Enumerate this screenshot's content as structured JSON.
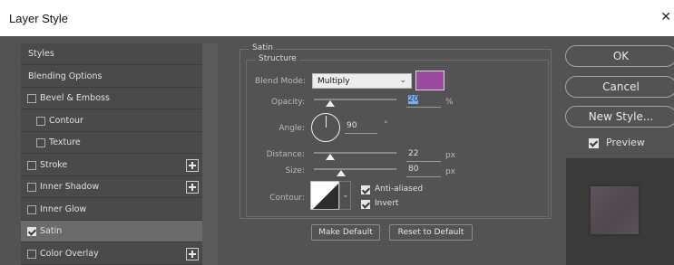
{
  "window": {
    "title": "Layer Style",
    "close_icon": "close-icon"
  },
  "sidebar": {
    "items": [
      {
        "label": "Styles",
        "checkbox": false,
        "checked": false,
        "plus": false,
        "indent": 0,
        "selected": false
      },
      {
        "label": "Blending Options",
        "checkbox": false,
        "checked": false,
        "plus": false,
        "indent": 0,
        "selected": false
      },
      {
        "label": "Bevel & Emboss",
        "checkbox": true,
        "checked": false,
        "plus": false,
        "indent": 0,
        "selected": false
      },
      {
        "label": "Contour",
        "checkbox": true,
        "checked": false,
        "plus": false,
        "indent": 1,
        "selected": false
      },
      {
        "label": "Texture",
        "checkbox": true,
        "checked": false,
        "plus": false,
        "indent": 1,
        "selected": false
      },
      {
        "label": "Stroke",
        "checkbox": true,
        "checked": false,
        "plus": true,
        "indent": 0,
        "selected": false
      },
      {
        "label": "Inner Shadow",
        "checkbox": true,
        "checked": false,
        "plus": true,
        "indent": 0,
        "selected": false
      },
      {
        "label": "Inner Glow",
        "checkbox": true,
        "checked": false,
        "plus": false,
        "indent": 0,
        "selected": false
      },
      {
        "label": "Satin",
        "checkbox": true,
        "checked": true,
        "plus": false,
        "indent": 0,
        "selected": true
      },
      {
        "label": "Color Overlay",
        "checkbox": true,
        "checked": false,
        "plus": true,
        "indent": 0,
        "selected": false
      }
    ]
  },
  "satin": {
    "section_title": "Satin",
    "structure_title": "Structure",
    "blend_mode_label": "Blend Mode:",
    "blend_mode_value": "Multiply",
    "blend_color": "#9b4aa0",
    "opacity_label": "Opacity:",
    "opacity_value": "20",
    "opacity_unit": "%",
    "opacity_level": 0.2,
    "angle_label": "Angle:",
    "angle_value": "90",
    "angle_unit": "°",
    "distance_label": "Distance:",
    "distance_value": "22",
    "distance_unit": "px",
    "distance_level": 0.2,
    "size_label": "Size:",
    "size_value": "80",
    "size_unit": "px",
    "size_level": 0.33,
    "contour_label": "Contour:",
    "anti_aliased_label": "Anti-aliased",
    "anti_aliased_checked": true,
    "invert_label": "Invert",
    "invert_checked": true,
    "make_default_label": "Make Default",
    "reset_default_label": "Reset to Default"
  },
  "buttons": {
    "ok_label": "OK",
    "cancel_label": "Cancel",
    "new_style_label": "New Style...",
    "preview_label": "Preview",
    "preview_checked": true
  },
  "colors": {
    "dialog_bg": "#535353",
    "panel_bg": "#4a4a4a",
    "selected_row": "#6b6b6b",
    "preview_bg": "#3a3a3a",
    "preview_swatch": "#554e55"
  }
}
